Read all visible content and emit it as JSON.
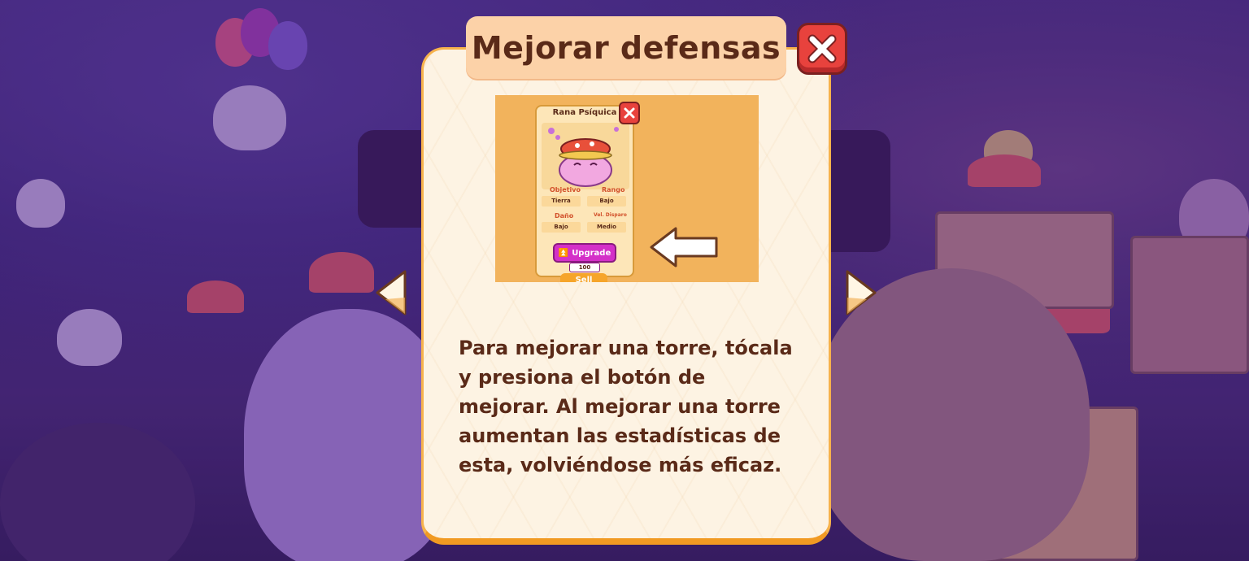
{
  "dialog": {
    "title": "Mejorar defensas",
    "close_icon": "close-icon",
    "prev_icon": "chevron-left-icon",
    "next_icon": "chevron-right-icon",
    "description": "Para mejorar una torre, tócala y presiona el botón de mejorar. Al mejorar una torre aumentan las estadísticas de esta, volviéndose más eficaz."
  },
  "tutorial_card": {
    "name": "Rana Psíquica",
    "stats": [
      {
        "label": "Objetivo",
        "value": "Tierra",
        "icon": "target-icon"
      },
      {
        "label": "Rango",
        "value": "Bajo",
        "icon": "range-icon"
      },
      {
        "label": "Daño",
        "value": "Bajo",
        "icon": "damage-icon"
      },
      {
        "label": "Vel. Disparo",
        "value": "Medio",
        "icon": "speed-icon"
      }
    ],
    "upgrade_label": "Upgrade",
    "upgrade_cost": "100",
    "sell_label": "Sell"
  },
  "colors": {
    "modal_bg": "#fdf3e3",
    "title_tab": "#fcd2a8",
    "title_text": "#5a2a18",
    "close_red": "#e8423d",
    "upgrade_magenta": "#d430c8",
    "panel_orange": "#f2b35c"
  }
}
